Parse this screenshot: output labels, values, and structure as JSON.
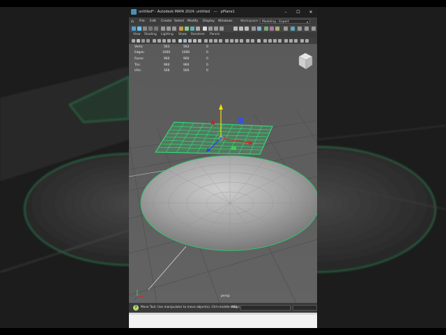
{
  "window": {
    "title": "untitled* - Autodesk MAYA 2024: untitled",
    "separator": "---",
    "object": "pPlane1",
    "min_glyph": "–",
    "max_glyph": "☐",
    "close_glyph": "✕"
  },
  "menubar": {
    "home_glyph": "⌂",
    "items": [
      "File",
      "Edit",
      "Create",
      "Select",
      "Modify",
      "Display",
      "Windows"
    ],
    "workspace_label": "Workspace :",
    "workspace_value": "Modeling - Expert",
    "workspace_caret": "▾"
  },
  "viewport_menu": {
    "items": [
      "View",
      "Shading",
      "Lighting",
      "Show",
      "Renderer",
      "Panels"
    ]
  },
  "hud": {
    "rows": [
      {
        "label": "Verts:",
        "a": "563",
        "b": "563",
        "c": "0"
      },
      {
        "label": "Edges:",
        "a": "1000",
        "b": "1000",
        "c": "0"
      },
      {
        "label": "Faces:",
        "a": "960",
        "b": "960",
        "c": "0"
      },
      {
        "label": "Tris:",
        "a": "960",
        "b": "960",
        "c": "0"
      },
      {
        "label": "UVs:",
        "a": "566",
        "b": "566",
        "c": "0"
      }
    ]
  },
  "camera_label": "persp",
  "help_line": {
    "icon": "?",
    "text": "Move Tool: Use manipulator to move object(s). Ctrl+middle-drag t",
    "mel_label": "MEL"
  },
  "colors": {
    "viewport_bg": "#5d5d5d",
    "wire_green": "#2ee87a",
    "grid_line": "#4a4a4a",
    "axis_x": "#e02020",
    "axis_y": "#f4e000",
    "axis_z": "#2040e0"
  },
  "icons": [
    "maya-logo-icon",
    "home-icon",
    "viewcube-icon",
    "help-icon",
    "axis-gizmo-icon",
    "move-manipulator-icon"
  ]
}
